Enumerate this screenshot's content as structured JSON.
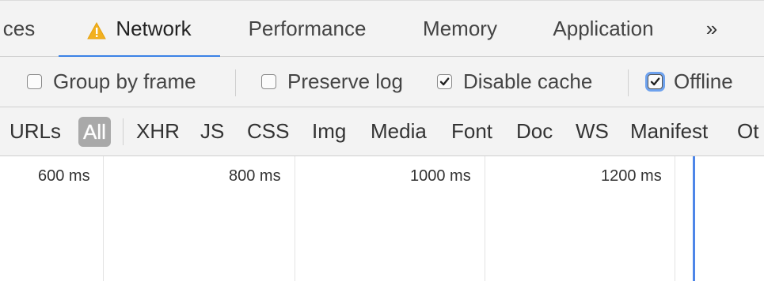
{
  "tabs": {
    "partial_left": "ces",
    "network": "Network",
    "performance": "Performance",
    "memory": "Memory",
    "application": "Application",
    "overflow": "»"
  },
  "options": {
    "group_by_frame": {
      "label": "Group by frame",
      "checked": false
    },
    "preserve_log": {
      "label": "Preserve log",
      "checked": false
    },
    "disable_cache": {
      "label": "Disable cache",
      "checked": true
    },
    "offline": {
      "label": "Offline",
      "checked": true
    }
  },
  "filters": {
    "urls_partial": "URLs",
    "all": "All",
    "xhr": "XHR",
    "js": "JS",
    "css": "CSS",
    "img": "Img",
    "media": "Media",
    "font": "Font",
    "doc": "Doc",
    "ws": "WS",
    "manifest": "Manifest",
    "other_partial": "Ot"
  },
  "timeline": {
    "ticks": [
      "600 ms",
      "800 ms",
      "1000 ms",
      "1200 ms"
    ]
  },
  "colors": {
    "accent": "#3b82e6",
    "warning": "#f2b01e",
    "toolbar_bg": "#f3f3f3",
    "active_filter_bg": "#a9a9a9"
  },
  "icons": {
    "warning": "warning-triangle-icon",
    "overflow": "chevron-double-right-icon",
    "check": "checkmark-icon"
  }
}
